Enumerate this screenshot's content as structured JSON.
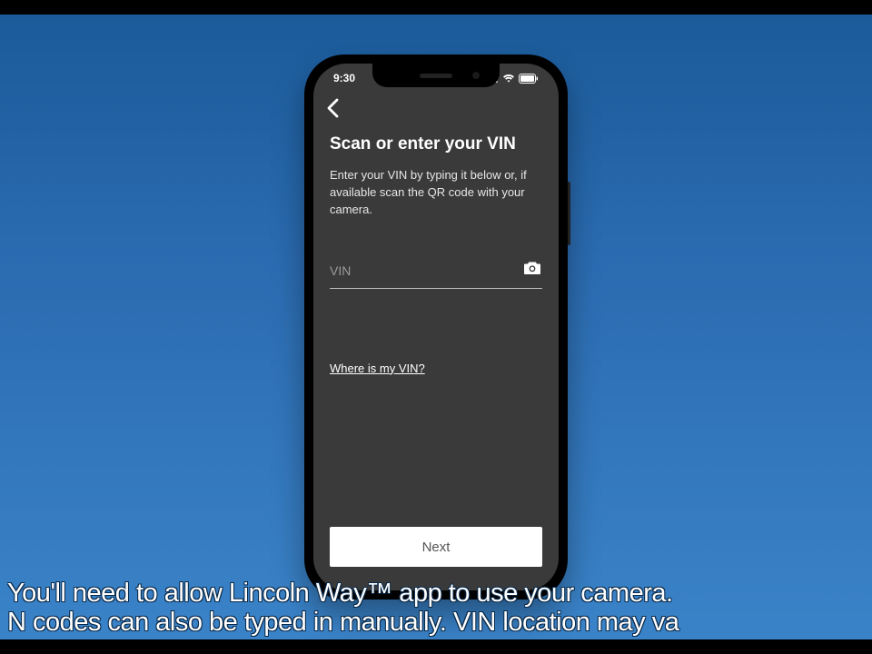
{
  "status": {
    "time": "9:30"
  },
  "screen": {
    "title": "Scan or enter your VIN",
    "body": "Enter your VIN by typing it below or, if available scan the QR code with your camera.",
    "vin_placeholder": "VIN",
    "help_link": "Where is my VIN?",
    "next": "Next"
  },
  "caption": {
    "line1": "You'll need to allow Lincoln Way™ app to use your camera.",
    "line2": "N codes can also be typed in manually. VIN location may va"
  }
}
